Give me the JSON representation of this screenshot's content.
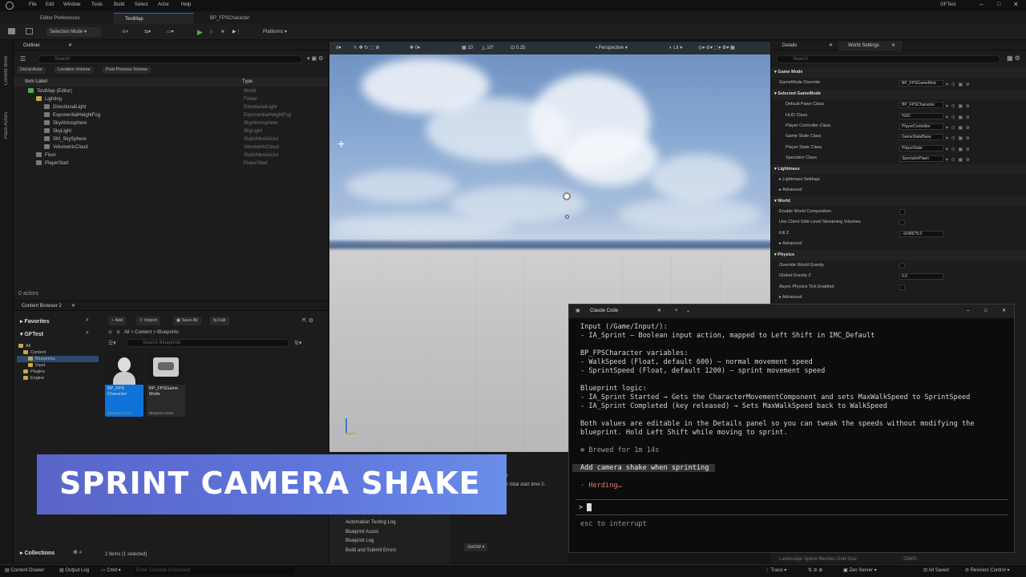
{
  "menubar": {
    "items": [
      "File",
      "Edit",
      "Window",
      "Tools",
      "Build",
      "Select",
      "Actor",
      "Help"
    ],
    "project": "GFTest"
  },
  "tabs": [
    "Editor Preferences",
    "TestMap",
    "BP_FPSCharacter"
  ],
  "toolbar": {
    "mode": "Selection Mode",
    "platforms": "Platforms"
  },
  "side_strip": {
    "content_browser": "Content Brow",
    "place_actors": "Place Actors"
  },
  "outliner": {
    "title": "Outliner",
    "search_placeholder": "Search",
    "filters": [
      "Decal Actor",
      "Location Volume",
      "Post Process Volume"
    ],
    "col_label": "Item Label",
    "col_type": "Type",
    "rows": [
      {
        "label": "TestMap (Editor)",
        "type": "World",
        "indent": 1
      },
      {
        "label": "Lighting",
        "type": "Folder",
        "indent": 2
      },
      {
        "label": "DirectionalLight",
        "type": "DirectionalLight",
        "indent": 3
      },
      {
        "label": "ExponentialHeightFog",
        "type": "ExponentialHeightFog",
        "indent": 3
      },
      {
        "label": "SkyAtmosphere",
        "type": "SkyAtmosphere",
        "indent": 3
      },
      {
        "label": "SkyLight",
        "type": "SkyLight",
        "indent": 3
      },
      {
        "label": "SM_SkySphere",
        "type": "StaticMeshActor",
        "indent": 3
      },
      {
        "label": "VolumetricCloud",
        "type": "VolumetricCloud",
        "indent": 3
      },
      {
        "label": "Floor",
        "type": "StaticMeshActor",
        "indent": 2
      },
      {
        "label": "PlayerStart",
        "type": "PlayerStart",
        "indent": 2
      }
    ],
    "count": "0 actors"
  },
  "viewport": {
    "perspective": "Perspective",
    "lit": "Lit",
    "grid": "10",
    "rot": "10°",
    "scale": "0.25"
  },
  "details": {
    "tab_details": "Details",
    "tab_world": "World Settings",
    "search_placeholder": "Search",
    "rows": [
      {
        "label": "Game Mode",
        "section": true
      },
      {
        "label": "GameMode Override",
        "value": "BP_FPSGameMod"
      },
      {
        "label": "Selected GameMode",
        "section": true
      },
      {
        "label": "Default Pawn Class",
        "value": "BP_FPSCharacter"
      },
      {
        "label": "HUD Class",
        "value": "HUD"
      },
      {
        "label": "Player Controller Class",
        "value": "PlayerController"
      },
      {
        "label": "Game State Class",
        "value": "GameStateBase"
      },
      {
        "label": "Player State Class",
        "value": "PlayerState"
      },
      {
        "label": "Spectator Class",
        "value": "SpectatorPawn"
      },
      {
        "label": "Lightmass",
        "section": true
      },
      {
        "label": "Lightmass Settings"
      },
      {
        "label": "Advanced"
      },
      {
        "label": "World",
        "section": true
      },
      {
        "label": "Enable World Composition",
        "check": true
      },
      {
        "label": "Use Client Side Level Streaming Volumes",
        "check": true
      },
      {
        "label": "Kill Z",
        "value": "-1048575.0"
      },
      {
        "label": "Advanced"
      },
      {
        "label": "Physics",
        "section": true
      },
      {
        "label": "Override World Gravity",
        "check": true
      },
      {
        "label": "Global Gravity Z",
        "value": "0.0"
      },
      {
        "label": "Async Physics Tick Enabled",
        "check": true
      },
      {
        "label": "Advanced"
      }
    ],
    "bottom_row": "Landscape Spline Meshes Grid Size",
    "bottom_value": "25600"
  },
  "content_browser": {
    "title": "Content Browser 2",
    "add": "Add",
    "import": "Import",
    "save_all": "Save All",
    "fab": "Fab",
    "favorites": "Favorites",
    "project": "GFTest",
    "path": [
      "All",
      "Content",
      "Blueprints"
    ],
    "search_placeholder": "Search Blueprints",
    "tree": [
      {
        "label": "All",
        "indent": 0
      },
      {
        "label": "Content",
        "indent": 1
      },
      {
        "label": "Blueprints",
        "indent": 2,
        "selected": true
      },
      {
        "label": "Input",
        "indent": 2
      },
      {
        "label": "Plugins",
        "indent": 1
      },
      {
        "label": "Engine",
        "indent": 1
      }
    ],
    "assets": [
      {
        "name": "BP_FPS Character",
        "cls": "Blueprint Class",
        "selected": true
      },
      {
        "name": "BP_FPSGame Mode",
        "cls": "Blueprint Class",
        "selected": false
      }
    ],
    "collections": "Collections",
    "status": "2 items (1 selected)"
  },
  "log_panel": {
    "items": [
      "Automation Testing Log",
      "Blueprint Assist",
      "Blueprint Log",
      "Build and Submit Errors"
    ],
    "show": "SHOW",
    "snippet1": "in",
    "snippet2": "or total start time 0."
  },
  "terminal": {
    "title": "Claude Code",
    "lines": [
      {
        "t": "Input (/Game/Input/):",
        "style": "n"
      },
      {
        "t": "- IA_Sprint — Boolean input action, mapped to Left Shift in IMC_Default",
        "style": "n"
      },
      {
        "t": "",
        "style": "gap"
      },
      {
        "t": "BP_FPSCharacter variables:",
        "style": "n"
      },
      {
        "t": "- WalkSpeed (Float, default 600) — normal movement speed",
        "style": "n"
      },
      {
        "t": "- SprintSpeed (Float, default 1200) — sprint movement speed",
        "style": "n"
      },
      {
        "t": "",
        "style": "gap"
      },
      {
        "t": "Blueprint logic:",
        "style": "n"
      },
      {
        "t": "- IA_Sprint Started → Gets the CharacterMovementComponent and sets MaxWalkSpeed to SprintSpeed",
        "style": "n"
      },
      {
        "t": "- IA_Sprint Completed (key released) → Sets MaxWalkSpeed back to WalkSpeed",
        "style": "n"
      },
      {
        "t": "",
        "style": "gap"
      },
      {
        "t": "Both values are editable in the Details panel so you can tweak the speeds without modifying the",
        "style": "n"
      },
      {
        "t": "blueprint. Hold Left Shift while moving to sprint.",
        "style": "n"
      },
      {
        "t": "",
        "style": "gap"
      }
    ],
    "brewed": "✻ Brewed for 1m 14s",
    "user_prompt": "Add camera shake when sprinting",
    "working": "· Herding…",
    "prompt_symbol": ">",
    "interrupt": "esc to interrupt"
  },
  "statusbar": {
    "content_drawer": "Content Drawer",
    "output_log": "Output Log",
    "cmd": "Cmd",
    "console_placeholder": "Enter Console Command",
    "trace": "Trace",
    "zen": "Zen Server",
    "saved": "All Saved",
    "revision": "Revision Control"
  },
  "banner": {
    "text": "SPRINT CAMERA SHAKE"
  },
  "colors": {
    "accent": "#0e72d8",
    "banner_start": "#5a64c8",
    "banner_end": "#6a8de8",
    "play_green": "#4caf50",
    "working_red": "#e07c6a"
  }
}
